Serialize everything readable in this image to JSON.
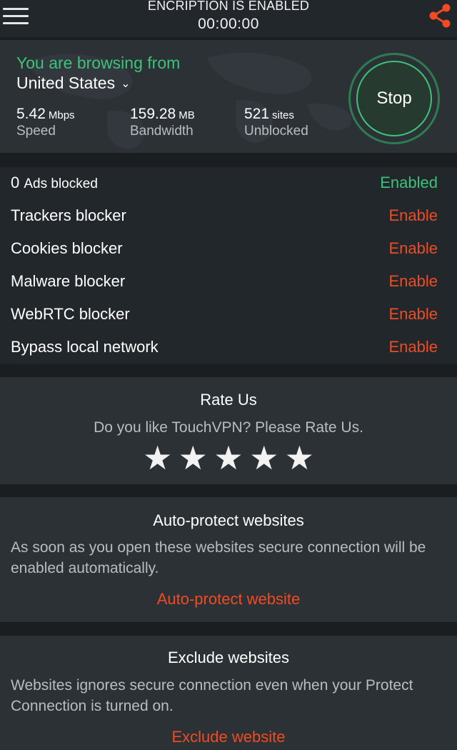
{
  "header": {
    "title": "ENCRIPTION IS ENABLED",
    "timer": "00:00:00",
    "menu_icon": "hamburger-menu-icon",
    "share_icon": "share-icon"
  },
  "connection": {
    "browsing_from_label": "You are browsing from",
    "country": "United States",
    "country_icon": "chevron-down-icon",
    "speed": {
      "value": "5.42",
      "unit": "Mbps",
      "label": "Speed"
    },
    "bandwidth": {
      "value": "159.28",
      "unit": "MB",
      "label": "Bandwidth"
    },
    "sites": {
      "value": "521",
      "unit": "sites",
      "label": "Unblocked"
    },
    "stop_label": "Stop"
  },
  "blockers": [
    {
      "count": "0",
      "name": "Ads blocked",
      "state": "Enabled",
      "color": "#3cc37a"
    },
    {
      "name": "Trackers blocker",
      "state": "Enable",
      "color": "#f04b23"
    },
    {
      "name": "Cookies blocker",
      "state": "Enable",
      "color": "#f04b23"
    },
    {
      "name": "Malware blocker",
      "state": "Enable",
      "color": "#f04b23"
    },
    {
      "name": "WebRTC blocker",
      "state": "Enable",
      "color": "#f04b23"
    },
    {
      "name": "Bypass local network",
      "state": "Enable",
      "color": "#f04b23"
    }
  ],
  "rate": {
    "title": "Rate Us",
    "text": "Do you like TouchVPN? Please Rate Us.",
    "stars": [
      "★",
      "★",
      "★",
      "★",
      "★"
    ]
  },
  "auto_protect": {
    "title": "Auto-protect websites",
    "text": "As soon as you open these websites secure connection will be enabled automatically.",
    "link": "Auto-protect website"
  },
  "exclude": {
    "title": "Exclude websites",
    "text": "Websites ignores secure connection even when your Protect Connection is turned on.",
    "link": "Exclude website"
  },
  "colors": {
    "accent_green": "#3cc37a",
    "accent_orange": "#f04b23",
    "background": "#1b1e21",
    "panel": "#2c3135"
  }
}
